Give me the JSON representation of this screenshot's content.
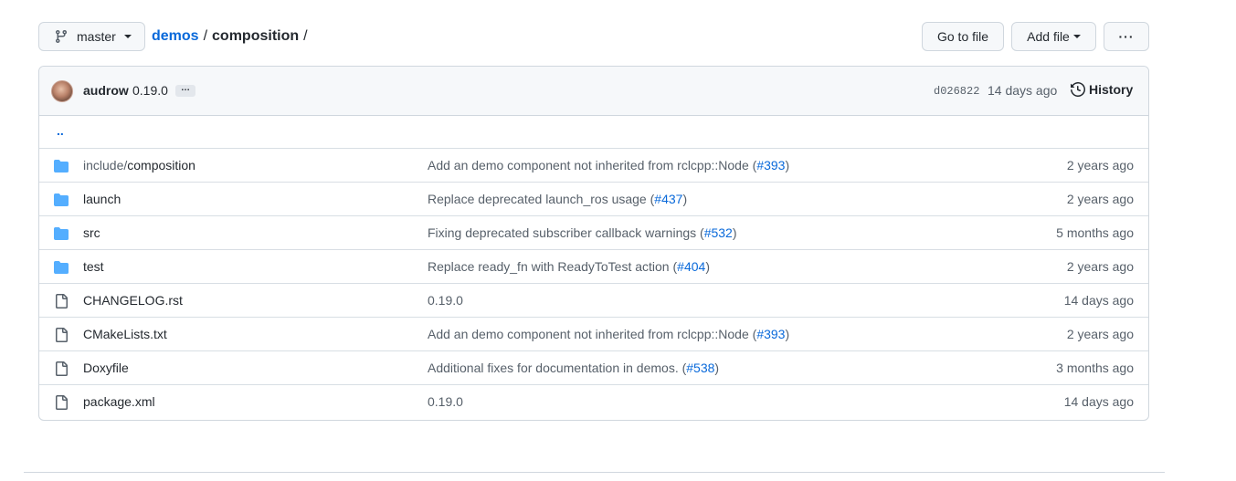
{
  "branch": {
    "label": "master"
  },
  "breadcrumb": {
    "repo": "demos",
    "separator": "/",
    "current": "composition",
    "trailing": "/"
  },
  "actions": {
    "go_to_file": "Go to file",
    "add_file": "Add file",
    "more": "···"
  },
  "latest_commit": {
    "author": "audrow",
    "message": "0.19.0",
    "ellipsis": "…",
    "sha": "d026822",
    "when": "14 days ago",
    "history_label": "History"
  },
  "parent_link": "..",
  "files": [
    {
      "type": "dir",
      "prefix": "include/",
      "name": "composition",
      "msg": "Add an demo component not inherited from rclcpp::Node (",
      "pr": "#393",
      "msg_end": ")",
      "age": "2 years ago"
    },
    {
      "type": "dir",
      "prefix": "",
      "name": "launch",
      "msg": "Replace deprecated launch_ros usage (",
      "pr": "#437",
      "msg_end": ")",
      "age": "2 years ago"
    },
    {
      "type": "dir",
      "prefix": "",
      "name": "src",
      "msg": "Fixing deprecated subscriber callback warnings (",
      "pr": "#532",
      "msg_end": ")",
      "age": "5 months ago"
    },
    {
      "type": "dir",
      "prefix": "",
      "name": "test",
      "msg": "Replace ready_fn with ReadyToTest action (",
      "pr": "#404",
      "msg_end": ")",
      "age": "2 years ago"
    },
    {
      "type": "file",
      "prefix": "",
      "name": "CHANGELOG.rst",
      "msg": "0.19.0",
      "pr": "",
      "msg_end": "",
      "age": "14 days ago"
    },
    {
      "type": "file",
      "prefix": "",
      "name": "CMakeLists.txt",
      "msg": "Add an demo component not inherited from rclcpp::Node (",
      "pr": "#393",
      "msg_end": ")",
      "age": "2 years ago"
    },
    {
      "type": "file",
      "prefix": "",
      "name": "Doxyfile",
      "msg": "Additional fixes for documentation in demos. (",
      "pr": "#538",
      "msg_end": ")",
      "age": "3 months ago"
    },
    {
      "type": "file",
      "prefix": "",
      "name": "package.xml",
      "msg": "0.19.0",
      "pr": "",
      "msg_end": "",
      "age": "14 days ago"
    }
  ],
  "colors": {
    "link": "#0969da",
    "folder": "#54aeff",
    "muted": "#57606a",
    "border": "#d0d7de"
  }
}
